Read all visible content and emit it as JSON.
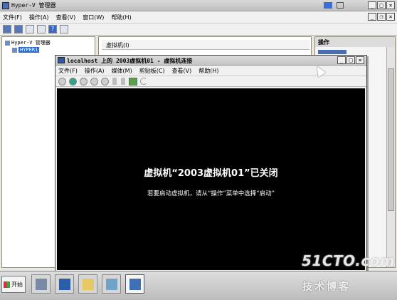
{
  "outer_window": {
    "title": "Hyper-V 管理器",
    "menu": [
      "文件(F)",
      "操作(A)",
      "查看(V)",
      "窗口(W)",
      "帮助(H)"
    ],
    "tree_root": "Hyper-V 管理器",
    "tree_child": "HYPER1",
    "center_header": "虚拟机(I)",
    "actions_header": "操作"
  },
  "vm_window": {
    "title": "localhost 上的 2003虚拟机01 - 虚拟机连接",
    "menu": [
      "文件(F)",
      "操作(A)",
      "媒体(M)",
      "剪贴板(C)",
      "查看(V)",
      "帮助(H)"
    ],
    "screen_message": "虚拟机“2003虚拟机01”已关闭",
    "screen_hint": "若要启动虚拟机，请从“操作”菜单中选择“启动”"
  },
  "taskbar": {
    "start_label": "开始"
  },
  "watermark": {
    "site": "51CTO.com",
    "tagline": "技术博客"
  },
  "icons": {
    "app": "hyperv-icon",
    "start": "windows-flag-icon",
    "server_manager": "server-manager-icon",
    "powershell": "powershell-icon",
    "explorer": "folder-icon",
    "network": "network-icon",
    "vm_connect": "vm-connect-icon"
  }
}
